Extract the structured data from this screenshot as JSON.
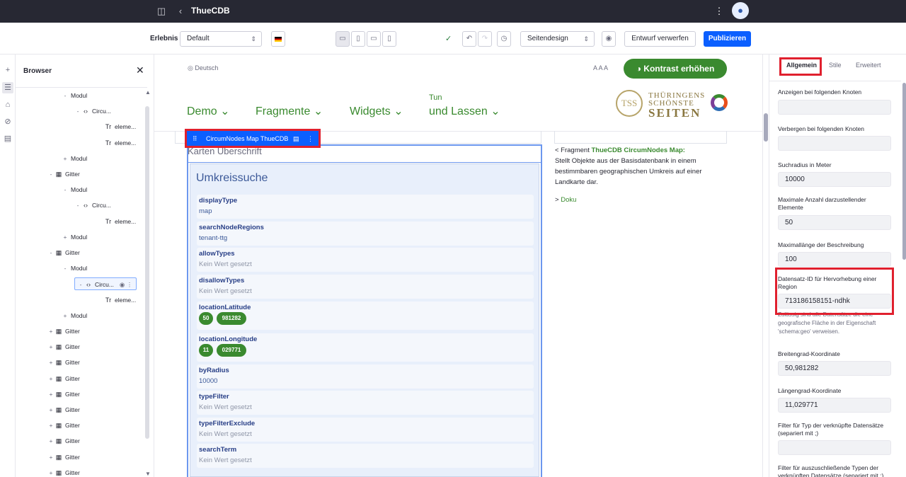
{
  "topbar": {
    "title": "ThueCDB",
    "sidebar_icon": "sidebar-toggle-icon",
    "back_icon": "chevron-left-icon",
    "more_icon": "kebab-icon",
    "avatar_icon": "user-icon"
  },
  "toolbar": {
    "experience_label": "Erlebnis",
    "experience_value": "Default",
    "language_flag": "german-flag-icon",
    "devices": [
      "desktop-icon",
      "tablet-icon",
      "landscape-icon",
      "mobile-icon"
    ],
    "status_icon": "check-circle-icon",
    "undo_icon": "undo-icon",
    "redo_icon": "redo-icon",
    "history_icon": "history-icon",
    "page_design": "Seitendesign",
    "preview_icon": "eye-icon",
    "discard_label": "Entwurf verwerfen",
    "publish_label": "Publizieren"
  },
  "leftrail": [
    "plus-icon",
    "browser-icon",
    "paint-icon",
    "link-icon",
    "comment-icon"
  ],
  "browser": {
    "title": "Browser",
    "items": [
      {
        "toggle": "-",
        "icon": "",
        "label": "Modul",
        "indent": 68
      },
      {
        "toggle": "-",
        "icon": "‹›",
        "label": "Circu...",
        "indent": 86
      },
      {
        "toggle": "",
        "icon": "Tr",
        "label": "eleme...",
        "indent": 118
      },
      {
        "toggle": "",
        "icon": "Tr",
        "label": "eleme...",
        "indent": 118
      },
      {
        "toggle": "+",
        "icon": "",
        "label": "Modul",
        "indent": 68
      },
      {
        "toggle": "-",
        "icon": "▦",
        "label": "Gitter",
        "indent": 48
      },
      {
        "toggle": "-",
        "icon": "",
        "label": "Modul",
        "indent": 68
      },
      {
        "toggle": "-",
        "icon": "‹›",
        "label": "Circu...",
        "indent": 86
      },
      {
        "toggle": "",
        "icon": "Tr",
        "label": "eleme...",
        "indent": 118
      },
      {
        "toggle": "+",
        "icon": "",
        "label": "Modul",
        "indent": 68
      },
      {
        "toggle": "-",
        "icon": "▦",
        "label": "Gitter",
        "indent": 48
      },
      {
        "toggle": "-",
        "icon": "",
        "label": "Modul",
        "indent": 68
      },
      {
        "toggle": "-",
        "icon": "‹›",
        "label": "Circu...",
        "indent": 86
      },
      {
        "toggle": "",
        "icon": "Tr",
        "label": "eleme...",
        "indent": 118
      },
      {
        "toggle": "+",
        "icon": "",
        "label": "Modul",
        "indent": 68
      },
      {
        "toggle": "+",
        "icon": "▦",
        "label": "Gitter",
        "indent": 48
      },
      {
        "toggle": "+",
        "icon": "▦",
        "label": "Gitter",
        "indent": 48
      },
      {
        "toggle": "+",
        "icon": "▦",
        "label": "Gitter",
        "indent": 48
      },
      {
        "toggle": "+",
        "icon": "▦",
        "label": "Gitter",
        "indent": 48
      },
      {
        "toggle": "+",
        "icon": "▦",
        "label": "Gitter",
        "indent": 48
      },
      {
        "toggle": "+",
        "icon": "▦",
        "label": "Gitter",
        "indent": 48
      },
      {
        "toggle": "+",
        "icon": "▦",
        "label": "Gitter",
        "indent": 48
      },
      {
        "toggle": "+",
        "icon": "▦",
        "label": "Gitter",
        "indent": 48
      },
      {
        "toggle": "+",
        "icon": "▦",
        "label": "Gitter",
        "indent": 48
      },
      {
        "toggle": "+",
        "icon": "▦",
        "label": "Gitter",
        "indent": 48
      }
    ]
  },
  "site": {
    "language": "Deutsch",
    "font_sizes": "A A A",
    "contrast_button": "Kontrast erhöhen",
    "nav": [
      "Demo",
      "Fragmente",
      "Widgets",
      "Tun",
      "und Lassen"
    ],
    "logo_text": [
      "TSS",
      "THÜRINGENS",
      "SCHÖNSTE",
      "SEITEN"
    ]
  },
  "fragment": {
    "label": "CircumNodes Map ThueCDB",
    "karten_heading": "Karten Überschrift",
    "title": "Umkreissuche",
    "props": [
      {
        "name": "displayType",
        "value": "map"
      },
      {
        "name": "searchNodeRegions",
        "value": "tenant-ttg"
      },
      {
        "name": "allowTypes",
        "value": "Kein Wert gesetzt"
      },
      {
        "name": "disallowTypes",
        "value": "Kein Wert gesetzt"
      },
      {
        "name": "locationLatitude",
        "pills": [
          "50",
          "981282"
        ]
      },
      {
        "name": "locationLongitude",
        "pills": [
          "11",
          "029771"
        ]
      },
      {
        "name": "byRadius",
        "value": "10000"
      },
      {
        "name": "typeFilter",
        "value": "Kein Wert gesetzt"
      },
      {
        "name": "typeFilterExclude",
        "value": "Kein Wert gesetzt"
      },
      {
        "name": "searchTerm",
        "value": "Kein Wert gesetzt"
      }
    ],
    "description_prefix": "< Fragment",
    "description_name": "ThueCDB CircumNodes Map:",
    "description_text": "Stellt Objekte aus der Basisdatenbank in einem bestimmbaren geographischen Umkreis auf einer Landkarte dar.",
    "doku_prefix": ">",
    "doku_link": "Doku"
  },
  "rpanel": {
    "tabs": [
      "Allgemein",
      "Stile",
      "Erweitert"
    ],
    "fields": [
      {
        "label": "Anzeigen bei folgenden Knoten",
        "value": ""
      },
      {
        "label": "Verbergen bei folgenden Knoten",
        "value": ""
      },
      {
        "label": "Suchradius in Meter",
        "value": "10000"
      },
      {
        "label": "Maximale Anzahl darzustellender Elemente",
        "value": "50"
      },
      {
        "label": "Maximallänge der Beschreibung",
        "value": "100"
      },
      {
        "label": "Datensatz-ID für Hervorhebung einer Region",
        "value": "713186158151-ndhk",
        "help": "Zulässig sind alle Datensätze die eine geografische Fläche in der Eigenschaft 'schema:geo' verweisen."
      },
      {
        "label": "Breitengrad-Koordinate",
        "value": "50,981282"
      },
      {
        "label": "Längengrad-Koordinate",
        "value": "11,029771"
      },
      {
        "label": "Filter für Typ der verknüpfte Datensätze (separiert mit ;)",
        "value": ""
      },
      {
        "label": "Filter für auszuschließende Typen der verknüpften Datensätze (separiert mit ;)",
        "value": ""
      }
    ]
  }
}
